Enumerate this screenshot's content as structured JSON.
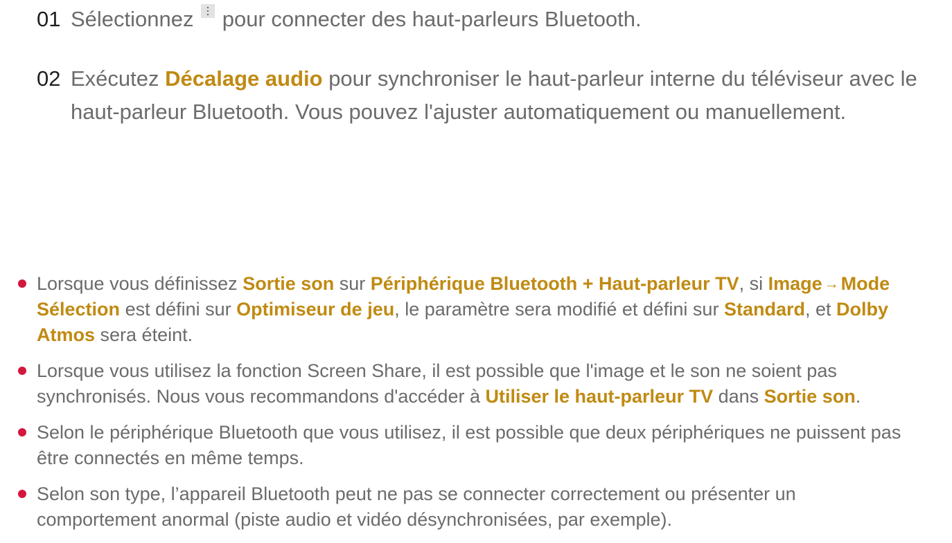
{
  "steps": [
    {
      "number": "01",
      "text_before_icon": "Sélectionnez",
      "icon": "more-vertical-icon",
      "text_after_icon": "pour connecter des haut-parleurs Bluetooth."
    },
    {
      "number": "02",
      "text_before": "Exécutez",
      "highlight": "Décalage audio",
      "text_after": "pour synchroniser le haut-parleur interne du téléviseur avec le haut-parleur Bluetooth. Vous pouvez l'ajuster automatiquement ou manuellement."
    }
  ],
  "notes": [
    {
      "p1": "Lorsque vous définissez",
      "h1": "Sortie son",
      "p2": "sur",
      "h2": "Périphérique Bluetooth + Haut-parleur TV",
      "p3": ", si",
      "h3": "Image",
      "arrow": "→",
      "h4": "Mode Sélection",
      "p4": "est défini sur",
      "h5": "Optimiseur de jeu",
      "p5": ", le paramètre sera modifié et défini sur",
      "h6": "Standard",
      "p6": ", et",
      "h7": "Dolby Atmos",
      "p7": "sera éteint."
    },
    {
      "p1": "Lorsque vous utilisez la fonction Screen Share, il est possible que l'image et le son ne soient pas synchronisés. Nous vous recommandons d'accéder à",
      "h1": "Utiliser le haut-parleur TV",
      "p2": "dans",
      "h2": "Sortie son",
      "p3": "."
    },
    {
      "text": "Selon le périphérique Bluetooth que vous utilisez, il est possible que deux périphériques ne puissent pas être connectés en même temps."
    },
    {
      "text": "Selon son type, l’appareil Bluetooth peut ne pas se connecter correctement ou présenter un comportement anormal (piste audio et vidéo désynchronisées, par exemple)."
    }
  ],
  "colors": {
    "highlight": "#c08a12",
    "bullet": "#d4173d",
    "text": "#6b6b6b",
    "step_number": "#1f1f1f"
  }
}
